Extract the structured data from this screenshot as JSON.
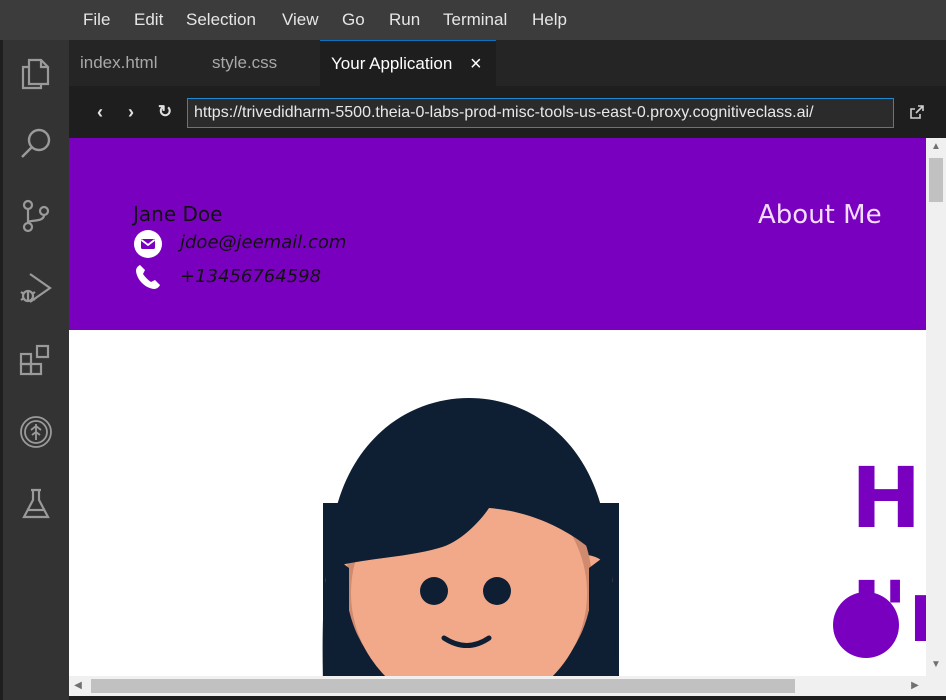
{
  "menu": {
    "items": [
      {
        "label": "File"
      },
      {
        "label": "Edit"
      },
      {
        "label": "Selection"
      },
      {
        "label": "View"
      },
      {
        "label": "Go"
      },
      {
        "label": "Run"
      },
      {
        "label": "Terminal"
      },
      {
        "label": "Help"
      }
    ]
  },
  "activity_bar": {
    "icons": [
      "explorer-icon",
      "search-icon",
      "source-control-icon",
      "run-debug-icon",
      "extensions-icon",
      "skills-network-icon",
      "lab-flask-icon"
    ]
  },
  "tabs": [
    {
      "label": "index.html"
    },
    {
      "label": "style.css"
    },
    {
      "label": "Your Application",
      "active": true
    }
  ],
  "browser": {
    "url": "https://trivedidharm-5500.theia-0-labs-prod-misc-tools-us-east-0.proxy.cognitiveclass.ai/",
    "back_glyph": "‹",
    "forward_glyph": "›",
    "refresh_glyph": "↻"
  },
  "page": {
    "name": "Jane Doe",
    "email": "jdoe@jeemail.com",
    "phone": "+13456764598",
    "nav_about": "About Me",
    "hero_line1": "Hi",
    "hero_line2": "I'm"
  },
  "colors": {
    "accent": "#7a00bf",
    "editor_bg": "#1e1e1e",
    "menubar_bg": "#3c3c3c",
    "activity_bg": "#333333",
    "url_border": "#1f8ad2"
  }
}
